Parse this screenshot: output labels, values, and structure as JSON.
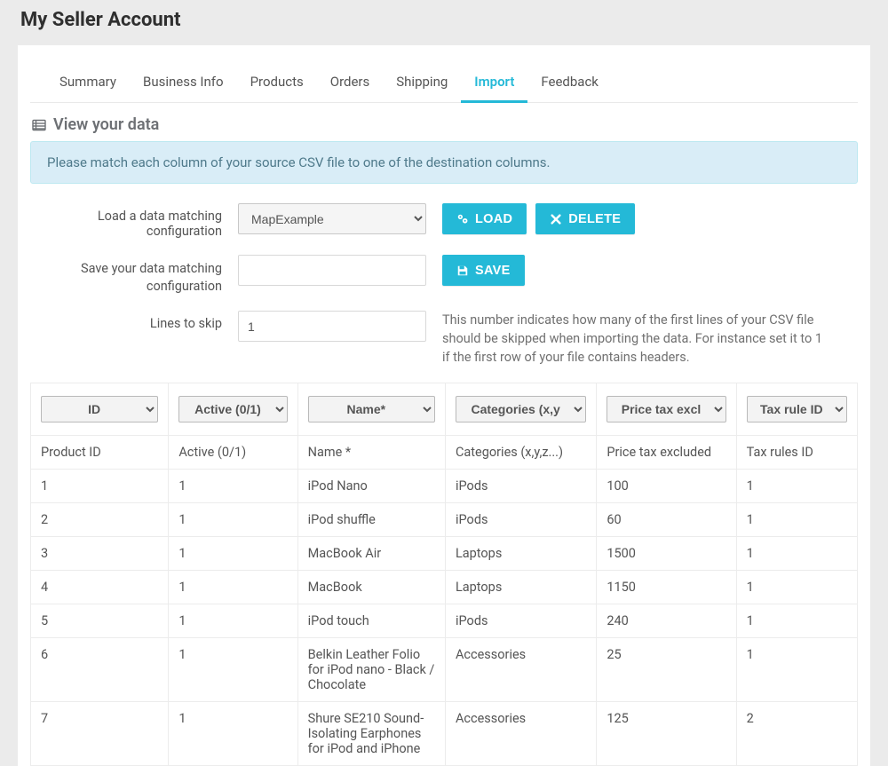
{
  "pageTitle": "My Seller Account",
  "tabs": [
    {
      "label": "Summary",
      "active": false
    },
    {
      "label": "Business Info",
      "active": false
    },
    {
      "label": "Products",
      "active": false
    },
    {
      "label": "Orders",
      "active": false
    },
    {
      "label": "Shipping",
      "active": false
    },
    {
      "label": "Import",
      "active": true
    },
    {
      "label": "Feedback",
      "active": false
    }
  ],
  "section": {
    "heading": "View your data"
  },
  "infoBox": "Please match each column of your source CSV file to one of the destination columns.",
  "form": {
    "loadLabel": "Load a data matching configuration",
    "loadOptions": [
      "MapExample"
    ],
    "loadSelected": "MapExample",
    "saveLabel": "Save your data matching configuration",
    "saveValue": "",
    "skipLabel": "Lines to skip",
    "skipValue": "1",
    "skipHelp": "This number indicates how many of the first lines of your CSV file should be skipped when importing the data. For instance set it to 1 if the first row of your file contains headers.",
    "buttons": {
      "load": "LOAD",
      "delete": "DELETE",
      "save": "SAVE"
    }
  },
  "columns": {
    "selects": [
      "ID",
      "Active (0/1)",
      "Name*",
      "Categories (x,y",
      "Price tax excl",
      "Tax rule ID"
    ],
    "headers": [
      "Product ID",
      "Active (0/1)",
      "Name *",
      "Categories (x,y,z...)",
      "Price tax excluded",
      "Tax rules ID"
    ]
  },
  "rows": [
    {
      "c1": "1",
      "c2": "1",
      "c3": "iPod Nano",
      "c4": "iPods",
      "c5": "100",
      "c6": "1"
    },
    {
      "c1": "2",
      "c2": "1",
      "c3": "iPod shuffle",
      "c4": "iPods",
      "c5": "60",
      "c6": "1"
    },
    {
      "c1": "3",
      "c2": "1",
      "c3": "MacBook Air",
      "c4": "Laptops",
      "c5": "1500",
      "c6": "1"
    },
    {
      "c1": "4",
      "c2": "1",
      "c3": "MacBook",
      "c4": "Laptops",
      "c5": "1150",
      "c6": "1"
    },
    {
      "c1": "5",
      "c2": "1",
      "c3": "iPod touch",
      "c4": "iPods",
      "c5": "240",
      "c6": "1"
    },
    {
      "c1": "6",
      "c2": "1",
      "c3": "Belkin Leather Folio for iPod nano - Black / Chocolate",
      "c4": "Accessories",
      "c5": "25",
      "c6": "1"
    },
    {
      "c1": "7",
      "c2": "1",
      "c3": "Shure SE210 Sound-Isolating Earphones for iPod and iPhone",
      "c4": "Accessories",
      "c5": "125",
      "c6": "2"
    }
  ]
}
